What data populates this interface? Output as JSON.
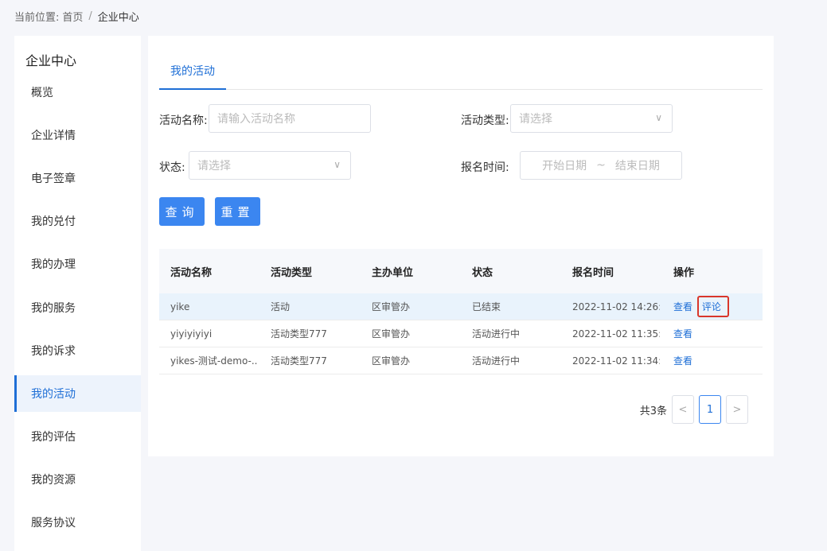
{
  "breadcrumb": {
    "prefix": "当前位置:",
    "home": "首页",
    "separator": "/",
    "current": "企业中心"
  },
  "sidebar": {
    "title": "企业中心",
    "items": [
      {
        "label": "概览",
        "active": false
      },
      {
        "label": "企业详情",
        "active": false
      },
      {
        "label": "电子签章",
        "active": false
      },
      {
        "label": "我的兑付",
        "active": false
      },
      {
        "label": "我的办理",
        "active": false
      },
      {
        "label": "我的服务",
        "active": false
      },
      {
        "label": "我的诉求",
        "active": false
      },
      {
        "label": "我的活动",
        "active": true
      },
      {
        "label": "我的评估",
        "active": false
      },
      {
        "label": "我的资源",
        "active": false
      },
      {
        "label": "服务协议",
        "active": false
      }
    ]
  },
  "tabs": [
    {
      "label": "我的活动",
      "active": true
    }
  ],
  "filters": {
    "name_label": "活动名称:",
    "name_placeholder": "请输入活动名称",
    "type_label": "活动类型:",
    "type_placeholder": "请选择",
    "status_label": "状态:",
    "status_placeholder": "请选择",
    "time_label": "报名时间:",
    "start_placeholder": "开始日期",
    "range_sep": "~",
    "end_placeholder": "结束日期"
  },
  "buttons": {
    "query": "查询",
    "reset": "重置"
  },
  "table": {
    "headers": [
      "活动名称",
      "活动类型",
      "主办单位",
      "状态",
      "报名时间",
      "操作"
    ],
    "rows": [
      {
        "name": "yike",
        "type": "活动",
        "org": "区审管办",
        "status": "已结束",
        "time": "2022-11-02 14:26:...",
        "view": "查看",
        "comment": "评论"
      },
      {
        "name": "yiyiyiyiyi",
        "type": "活动类型777",
        "org": "区审管办",
        "status": "活动进行中",
        "time": "2022-11-02 11:35:...",
        "view": "查看"
      },
      {
        "name": "yikes-测试-demo-...",
        "type": "活动类型777",
        "org": "区审管办",
        "status": "活动进行中",
        "time": "2022-11-02 11:34:...",
        "view": "查看"
      }
    ]
  },
  "pagination": {
    "total": "共3条",
    "prev": "<",
    "current": "1",
    "next": ">"
  },
  "colors": {
    "accent": "#1f6fd6",
    "button": "#3b86f0",
    "highlight_border": "#d9362b"
  }
}
